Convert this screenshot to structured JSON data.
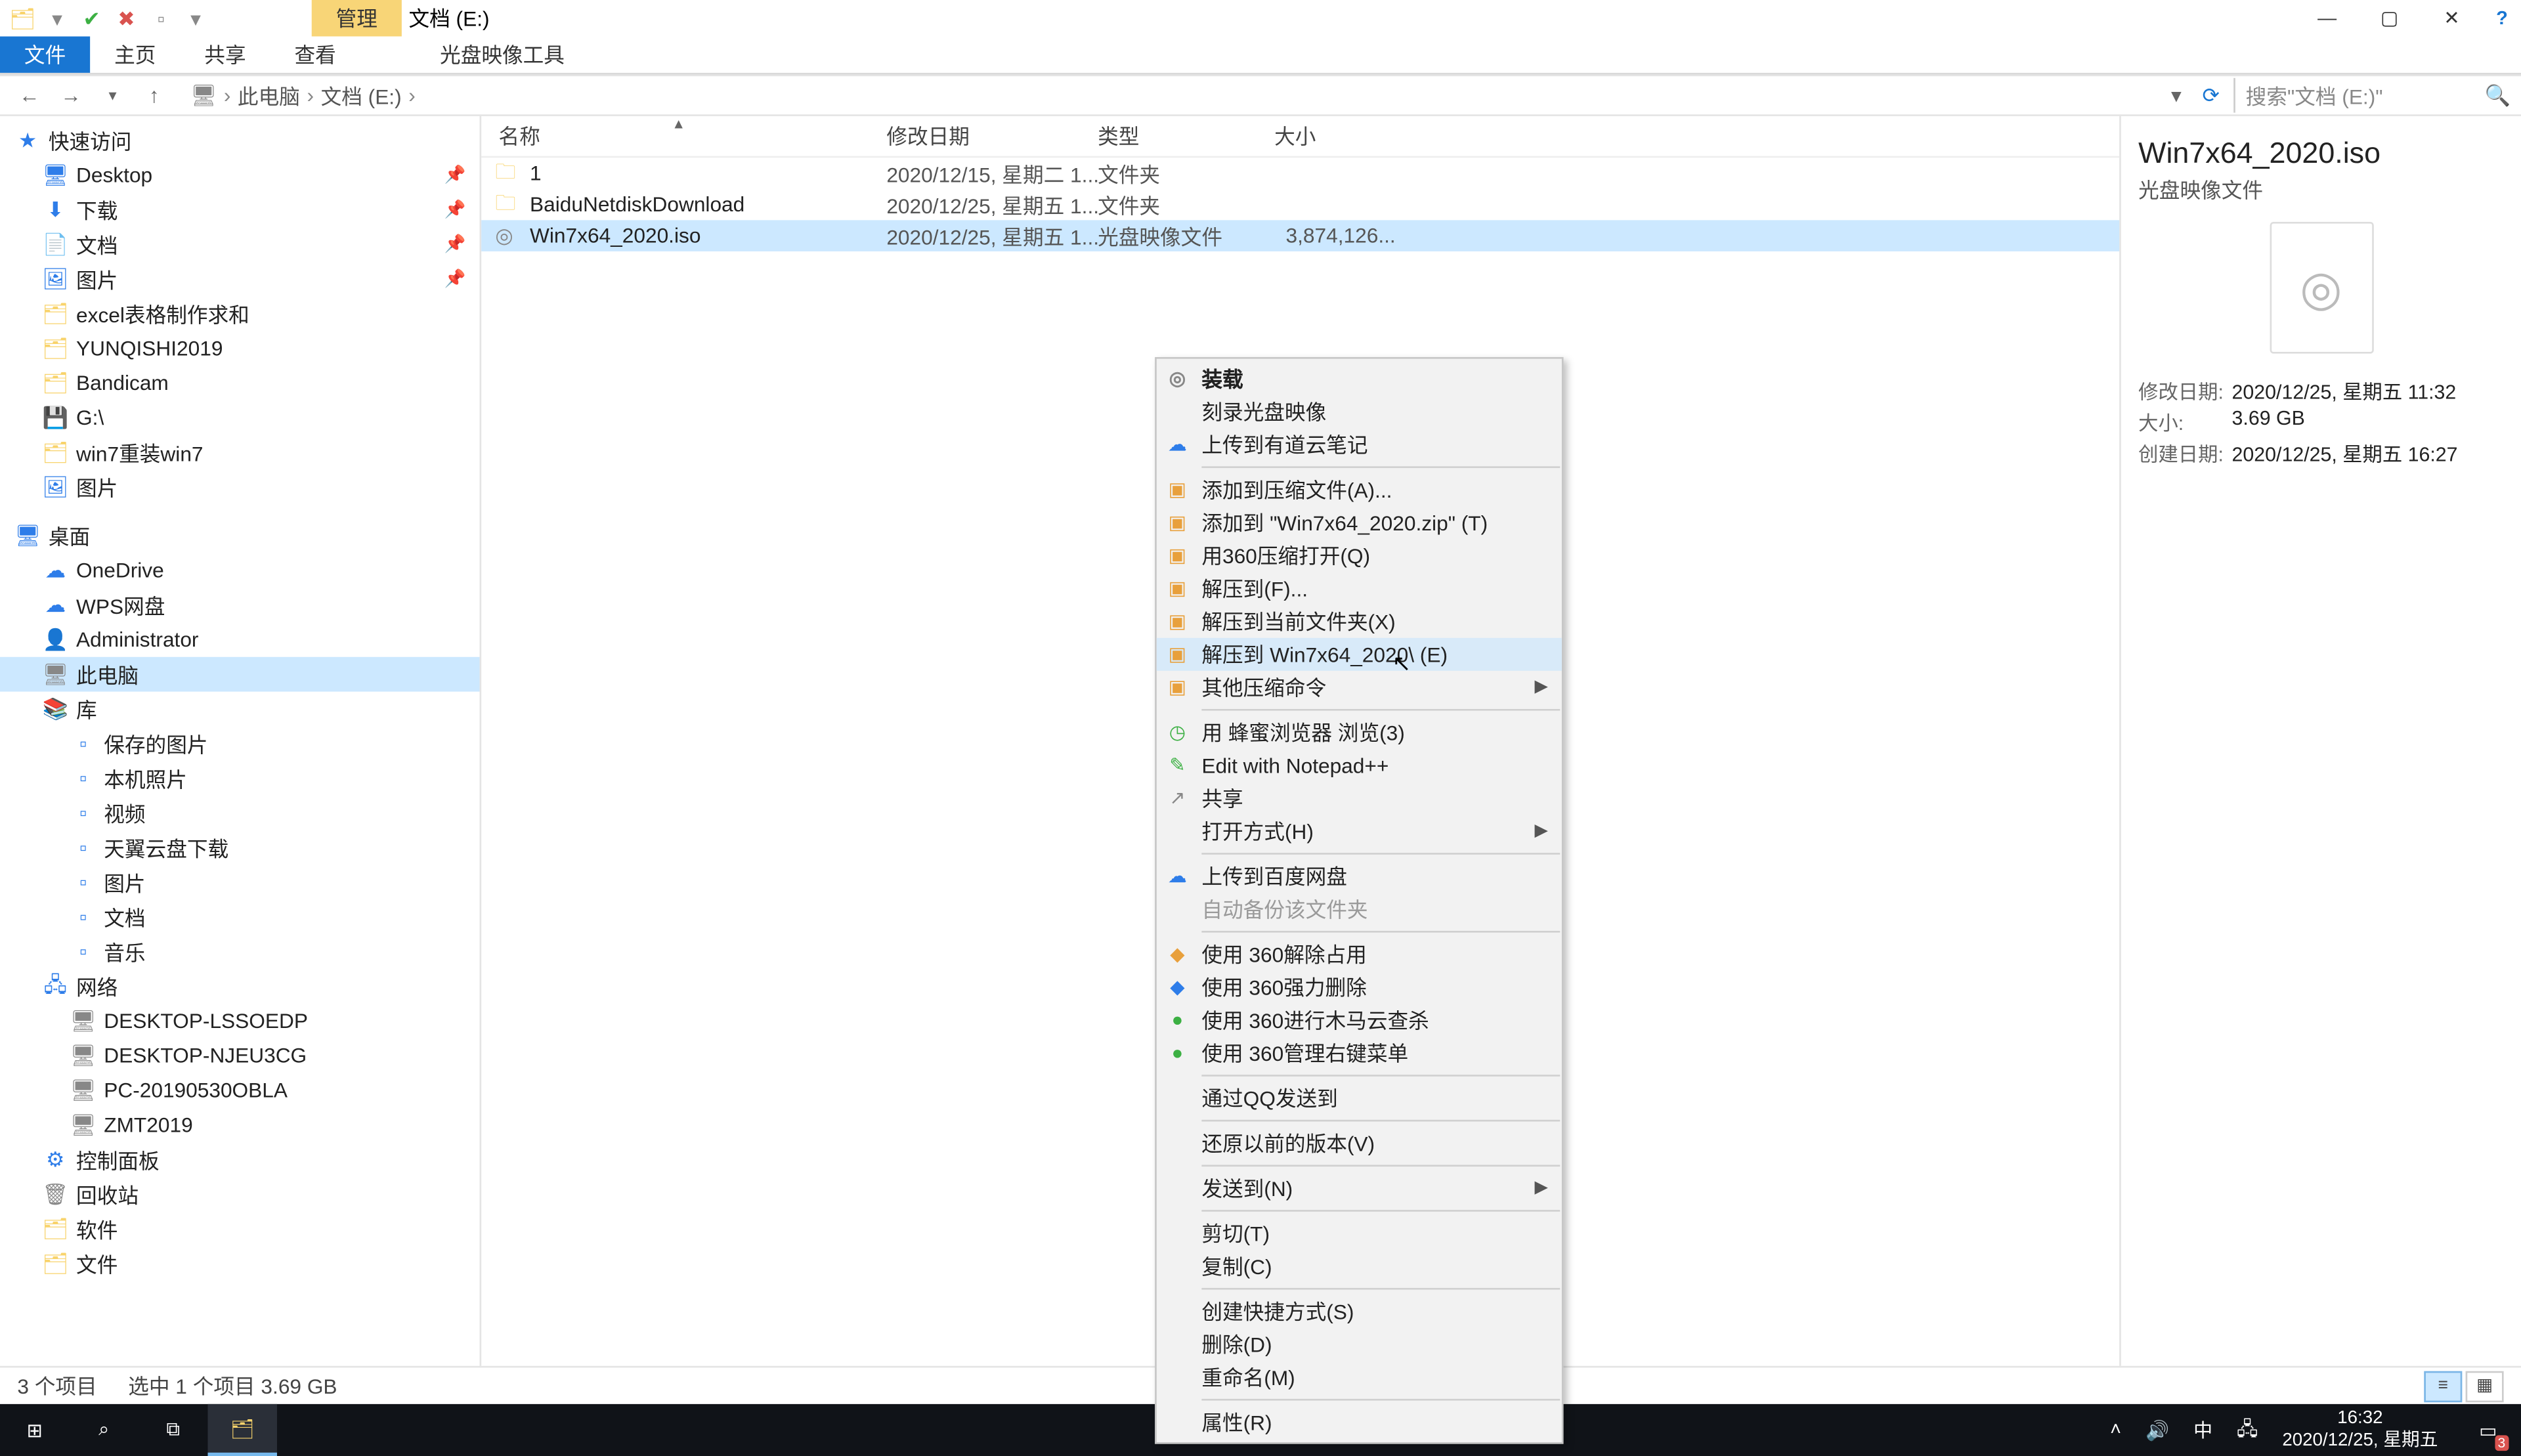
{
  "titlebar": {
    "context_tab": "管理",
    "title": "文档 (E:)"
  },
  "ribbon": {
    "file": "文件",
    "home": "主页",
    "share": "共享",
    "view": "查看",
    "disc_tools": "光盘映像工具"
  },
  "addr": {
    "root": "此电脑",
    "loc": "文档 (E:)",
    "search_placeholder": "搜索\"文档 (E:)\""
  },
  "tree": {
    "quick_access": "快速访问",
    "quick": [
      "Desktop",
      "下载",
      "文档",
      "图片",
      "excel表格制作求和",
      "YUNQISHI2019",
      "Bandicam",
      "G:\\",
      "win7重装win7",
      "图片"
    ],
    "desktop_root": "桌面",
    "desktop": [
      "OneDrive",
      "WPS网盘",
      "Administrator",
      "此电脑",
      "库"
    ],
    "libs": [
      "保存的图片",
      "本机照片",
      "视频",
      "天翼云盘下载",
      "图片",
      "文档",
      "音乐"
    ],
    "network": "网络",
    "net": [
      "DESKTOP-LSSOEDP",
      "DESKTOP-NJEU3CG",
      "PC-20190530OBLA",
      "ZMT2019"
    ],
    "misc": [
      "控制面板",
      "回收站",
      "软件",
      "文件"
    ]
  },
  "cols": {
    "name": "名称",
    "date": "修改日期",
    "type": "类型",
    "size": "大小"
  },
  "rows": [
    {
      "icon": "folder",
      "name": "1",
      "date": "2020/12/15, 星期二 1...",
      "type": "文件夹",
      "size": ""
    },
    {
      "icon": "folder",
      "name": "BaiduNetdiskDownload",
      "date": "2020/12/25, 星期五 1...",
      "type": "文件夹",
      "size": ""
    },
    {
      "icon": "iso",
      "name": "Win7x64_2020.iso",
      "date": "2020/12/25, 星期五 1...",
      "type": "光盘映像文件",
      "size": "3,874,126..."
    }
  ],
  "ctx": {
    "mount": "装载",
    "burn": "刻录光盘映像",
    "youdao": "上传到有道云笔记",
    "add_archive": "添加到压缩文件(A)...",
    "add_zip": "添加到 \"Win7x64_2020.zip\" (T)",
    "open_360zip": "用360压缩打开(Q)",
    "extract_to": "解压到(F)...",
    "extract_here": "解压到当前文件夹(X)",
    "extract_named": "解压到 Win7x64_2020\\ (E)",
    "other_zip": "其他压缩命令",
    "bee": "用 蜂蜜浏览器 浏览(3)",
    "npp": "Edit with Notepad++",
    "share": "共享",
    "open_with": "打开方式(H)",
    "baidu_up": "上传到百度网盘",
    "auto_backup": "自动备份该文件夹",
    "unlock360": "使用 360解除占用",
    "force_del360": "使用 360强力删除",
    "trojan360": "使用 360进行木马云查杀",
    "mgr360": "使用 360管理右键菜单",
    "qq_send": "通过QQ发送到",
    "restore": "还原以前的版本(V)",
    "send_to": "发送到(N)",
    "cut": "剪切(T)",
    "copy": "复制(C)",
    "shortcut": "创建快捷方式(S)",
    "delete": "删除(D)",
    "rename": "重命名(M)",
    "props": "属性(R)"
  },
  "details": {
    "name": "Win7x64_2020.iso",
    "type": "光盘映像文件",
    "mod_k": "修改日期:",
    "mod_v": "2020/12/25, 星期五 11:32",
    "size_k": "大小:",
    "size_v": "3.69 GB",
    "create_k": "创建日期:",
    "create_v": "2020/12/25, 星期五 16:27"
  },
  "status": {
    "count": "3 个项目",
    "sel": "选中 1 个项目  3.69 GB"
  },
  "taskbar": {
    "ime": "中",
    "time": "16:32",
    "date": "2020/12/25, 星期五",
    "badge": "3"
  }
}
